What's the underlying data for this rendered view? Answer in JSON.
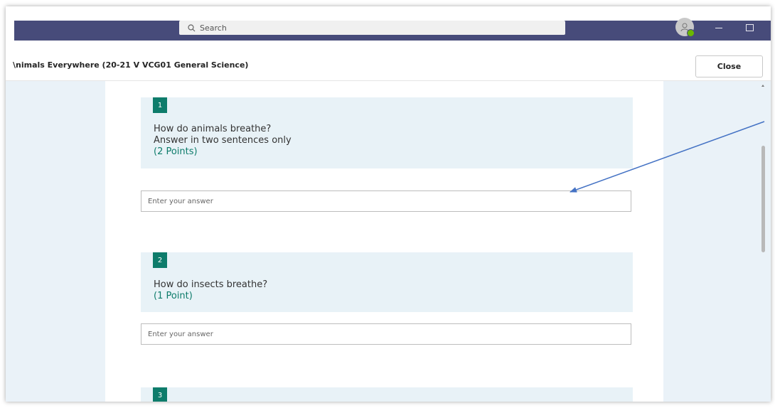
{
  "titlebar": {
    "search_placeholder": "Search",
    "colors": {
      "bar": "#474b7a",
      "presence": "#6bb700"
    }
  },
  "header": {
    "title": "\\nimals Everywhere (20-21 V VCG01 General Science)",
    "close_label": "Close"
  },
  "questions": [
    {
      "number": "1",
      "lines": [
        "How do animals breathe?",
        "Answer in two sentences only"
      ],
      "points": "(2 Points)",
      "answer_placeholder": "Enter your answer"
    },
    {
      "number": "2",
      "lines": [
        "How do insects breathe?"
      ],
      "points": "(1 Point)",
      "answer_placeholder": "Enter your answer"
    },
    {
      "number": "3"
    }
  ],
  "colors": {
    "accent": "#0e7c6b",
    "card_bg": "#e8f2f7",
    "side_bg": "#eaf2f8",
    "arrow": "#4472c4"
  },
  "icons": [
    "search-icon",
    "avatar-icon",
    "minimize-icon",
    "maximize-icon",
    "arrow-annotation"
  ]
}
